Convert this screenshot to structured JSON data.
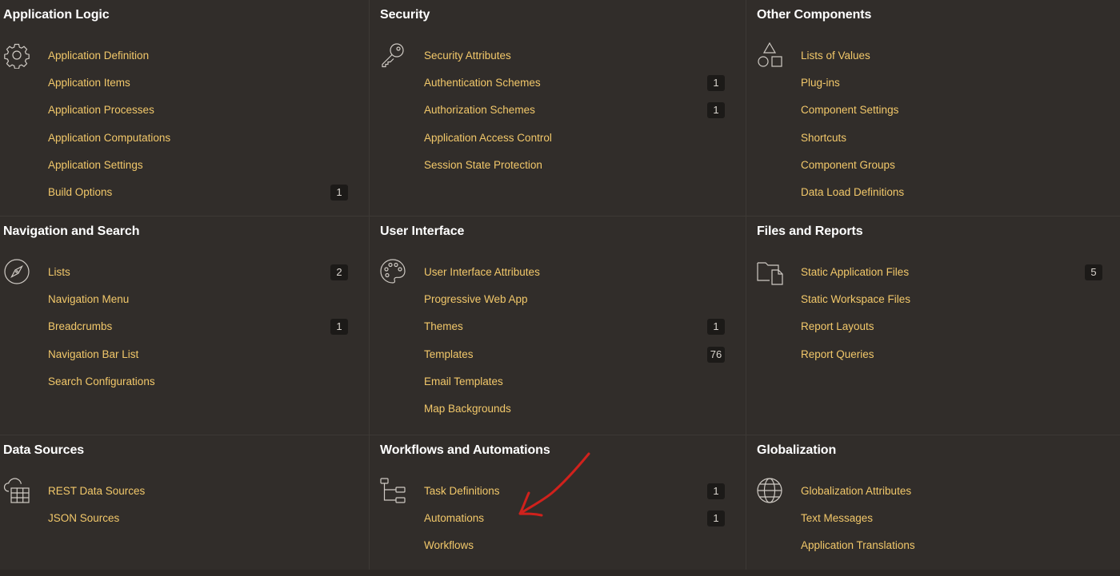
{
  "panels": [
    {
      "title": "Application Logic",
      "icon": "gear-icon",
      "items": [
        {
          "label": "Application Definition",
          "badge": ""
        },
        {
          "label": "Application Items",
          "badge": ""
        },
        {
          "label": "Application Processes",
          "badge": ""
        },
        {
          "label": "Application Computations",
          "badge": ""
        },
        {
          "label": "Application Settings",
          "badge": ""
        },
        {
          "label": "Build Options",
          "badge": "1"
        }
      ]
    },
    {
      "title": "Security",
      "icon": "key-icon",
      "items": [
        {
          "label": "Security Attributes",
          "badge": ""
        },
        {
          "label": "Authentication Schemes",
          "badge": "1"
        },
        {
          "label": "Authorization Schemes",
          "badge": "1"
        },
        {
          "label": "Application Access Control",
          "badge": ""
        },
        {
          "label": "Session State Protection",
          "badge": ""
        }
      ]
    },
    {
      "title": "Other Components",
      "icon": "shapes-icon",
      "items": [
        {
          "label": "Lists of Values",
          "badge": ""
        },
        {
          "label": "Plug-ins",
          "badge": ""
        },
        {
          "label": "Component Settings",
          "badge": ""
        },
        {
          "label": "Shortcuts",
          "badge": ""
        },
        {
          "label": "Component Groups",
          "badge": ""
        },
        {
          "label": "Data Load Definitions",
          "badge": ""
        }
      ]
    },
    {
      "title": "Navigation and Search",
      "icon": "compass-icon",
      "items": [
        {
          "label": "Lists",
          "badge": "2"
        },
        {
          "label": "Navigation Menu",
          "badge": ""
        },
        {
          "label": "Breadcrumbs",
          "badge": "1"
        },
        {
          "label": "Navigation Bar List",
          "badge": ""
        },
        {
          "label": "Search Configurations",
          "badge": ""
        }
      ]
    },
    {
      "title": "User Interface",
      "icon": "palette-icon",
      "items": [
        {
          "label": "User Interface Attributes",
          "badge": ""
        },
        {
          "label": "Progressive Web App",
          "badge": ""
        },
        {
          "label": "Themes",
          "badge": "1"
        },
        {
          "label": "Templates",
          "badge": "76"
        },
        {
          "label": "Email Templates",
          "badge": ""
        },
        {
          "label": "Map Backgrounds",
          "badge": ""
        }
      ]
    },
    {
      "title": "Files and Reports",
      "icon": "folder-file-icon",
      "items": [
        {
          "label": "Static Application Files",
          "badge": "5"
        },
        {
          "label": "Static Workspace Files",
          "badge": ""
        },
        {
          "label": "Report Layouts",
          "badge": ""
        },
        {
          "label": "Report Queries",
          "badge": ""
        }
      ]
    },
    {
      "title": "Data Sources",
      "icon": "cloud-grid-icon",
      "items": [
        {
          "label": "REST Data Sources",
          "badge": ""
        },
        {
          "label": "JSON Sources",
          "badge": ""
        }
      ]
    },
    {
      "title": "Workflows and Automations",
      "icon": "workflow-tree-icon",
      "items": [
        {
          "label": "Task Definitions",
          "badge": "1"
        },
        {
          "label": "Automations",
          "badge": "1"
        },
        {
          "label": "Workflows",
          "badge": ""
        }
      ]
    },
    {
      "title": "Globalization",
      "icon": "globe-icon",
      "items": [
        {
          "label": "Globalization Attributes",
          "badge": ""
        },
        {
          "label": "Text Messages",
          "badge": ""
        },
        {
          "label": "Application Translations",
          "badge": ""
        }
      ]
    }
  ],
  "colors": {
    "background": "#312d2a",
    "link": "#f2c86a",
    "heading": "#ffffff",
    "badge_bg": "#1c1a18",
    "annotation": "#d0211c"
  }
}
